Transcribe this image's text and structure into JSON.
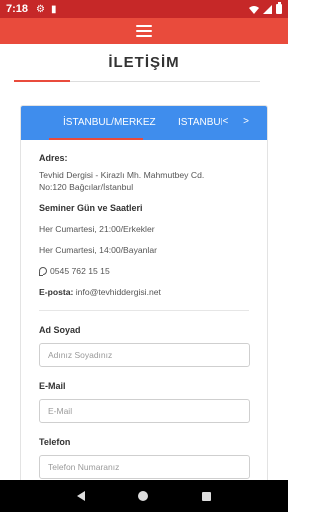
{
  "status_bar": {
    "time": "7:18",
    "left_icons": [
      "gear-icon",
      "sd-card-icon"
    ],
    "right_icons": [
      "wifi-icon",
      "signal-icon",
      "battery-icon"
    ]
  },
  "appbar": {
    "menu_icon": "hamburger-menu-icon",
    "color": "#e94b3c"
  },
  "page": {
    "title": "İLETİŞİM"
  },
  "tabs": {
    "items": [
      {
        "label": "İSTANBUL/MERKEZ",
        "active": true
      },
      {
        "label": "İSTANBUL"
      }
    ],
    "prev": "<",
    "next": ">",
    "accent": "#3f8ded"
  },
  "contact": {
    "address_label": "Adres:",
    "address_line1": "Tevhid Dergisi - Kirazlı Mh. Mahmutbey Cd.",
    "address_line2": "No:120 Bağcılar/İstanbul",
    "seminar_title": "Seminer Gün ve Saatleri",
    "seminar_men": "Her Cumartesi, 21:00/Erkekler",
    "seminar_women": "Her Cumartesi, 14:00/Bayanlar",
    "phone": "0545 762 15 15",
    "phone_icon": "whatsapp-icon",
    "email_label": "E-posta:",
    "email": "info@tevhiddergisi.net"
  },
  "form": {
    "name_label": "Ad Soyad",
    "name_placeholder": "Adınız Soyadınız",
    "email_label": "E-Mail",
    "email_placeholder": "E-Mail",
    "phone_label": "Telefon",
    "phone_placeholder": "Telefon Numaranız"
  },
  "nav_bar": {
    "icons": [
      "back-icon",
      "home-icon",
      "recents-icon"
    ]
  }
}
